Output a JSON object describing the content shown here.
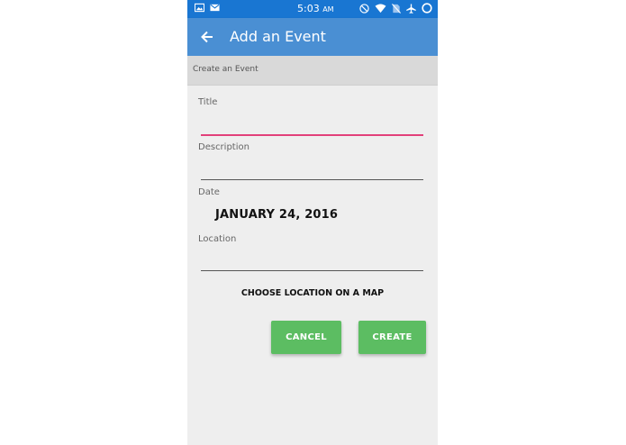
{
  "status_bar": {
    "time": "5:03",
    "ampm": "AM",
    "left_icons": [
      "image-icon",
      "mail-icon"
    ],
    "right_icons": [
      "do-not-disturb-icon",
      "wifi-icon",
      "no-sim-icon",
      "airplane-icon",
      "circle-icon"
    ]
  },
  "app_bar": {
    "title": "Add an Event",
    "back_icon": "arrow-back-icon"
  },
  "section": {
    "header": "Create an Event"
  },
  "form": {
    "title_label": "Title",
    "title_value": "",
    "description_label": "Description",
    "description_value": "",
    "date_label": "Date",
    "date_value": "JANUARY 24, 2016",
    "location_label": "Location",
    "location_value": "",
    "map_link": "CHOOSE LOCATION ON A MAP"
  },
  "actions": {
    "cancel_label": "CANCEL",
    "create_label": "CREATE"
  },
  "colors": {
    "status_bar": "#1976d2",
    "app_bar": "#4a8fd3",
    "accent_focus": "#e2407a",
    "button": "#5cbd62"
  }
}
